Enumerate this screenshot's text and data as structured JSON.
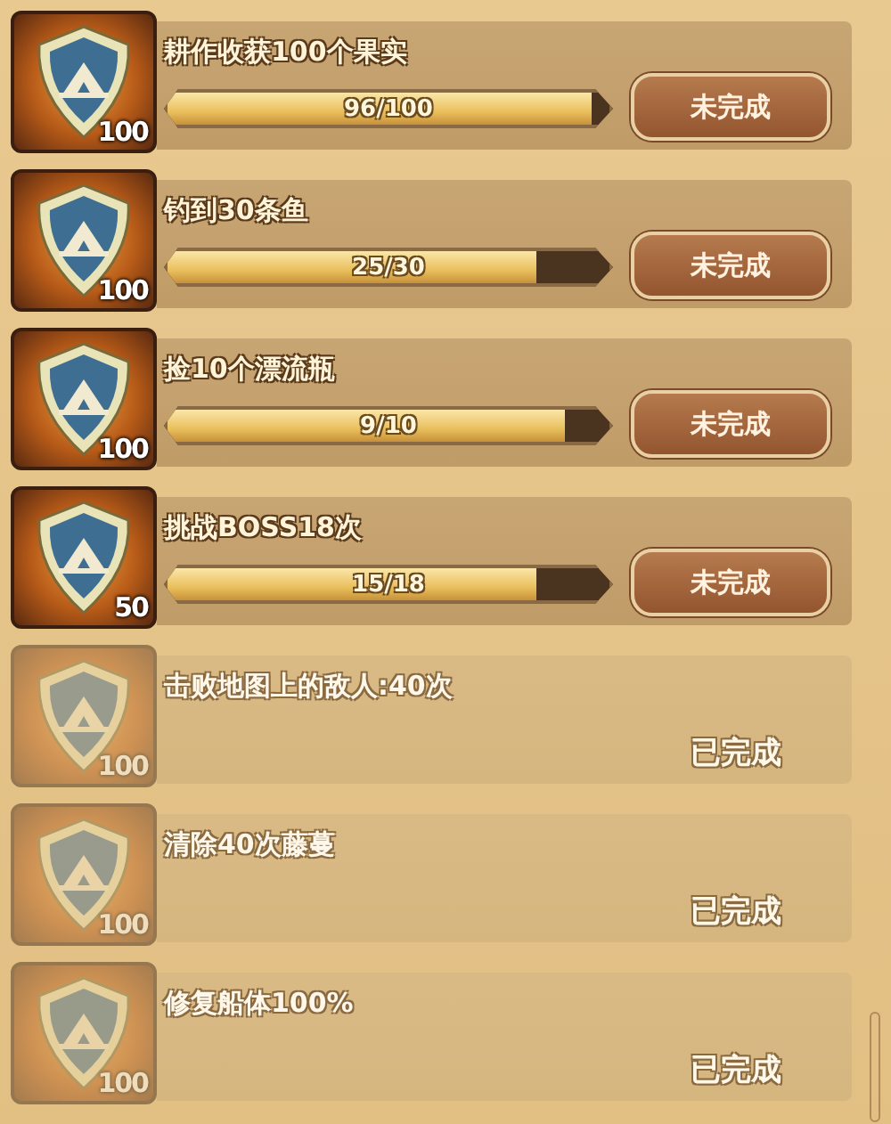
{
  "quests": [
    {
      "title": "耕作收获100个果实",
      "reward": "100",
      "completed": false,
      "progress": "96/100",
      "level": 0.96,
      "status": "未完成"
    },
    {
      "title": "钓到30条鱼",
      "reward": "100",
      "completed": false,
      "progress": "25/30",
      "level": 0.833,
      "status": "未完成"
    },
    {
      "title": "捡10个漂流瓶",
      "reward": "100",
      "completed": false,
      "progress": "9/10",
      "level": 0.9,
      "status": "未完成"
    },
    {
      "title": "挑战BOSS18次",
      "reward": "50",
      "completed": false,
      "progress": "15/18",
      "level": 0.833,
      "status": "未完成"
    },
    {
      "title": "击败地图上的敌人:40次",
      "reward": "100",
      "completed": true,
      "status": "已完成"
    },
    {
      "title": "清除40次藤蔓",
      "reward": "100",
      "completed": true,
      "status": "已完成"
    },
    {
      "title": "修复船体100%",
      "reward": "100",
      "completed": true,
      "status": "已完成"
    }
  ]
}
